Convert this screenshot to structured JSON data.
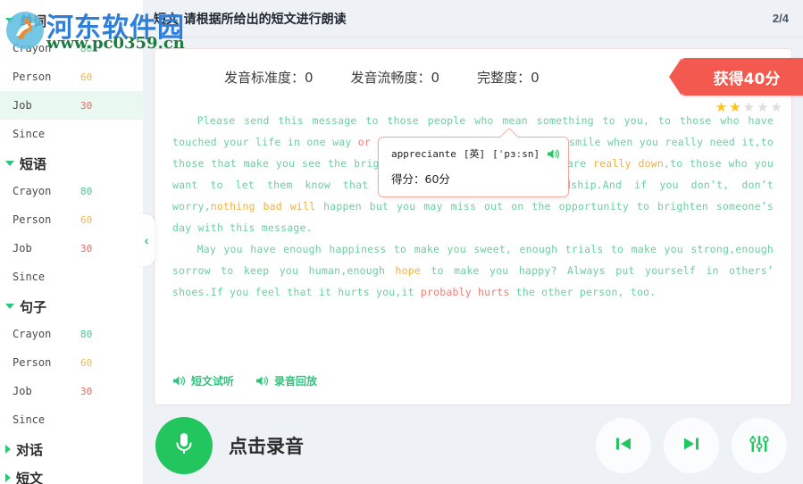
{
  "watermark": {
    "name": "河东软件园",
    "url": "www.pc0359.cn"
  },
  "sidebar": {
    "groups": [
      {
        "title": "单词",
        "expanded": true,
        "items": [
          {
            "label": "Crayon",
            "score": "80",
            "tone": "green",
            "active": false
          },
          {
            "label": "Person",
            "score": "60",
            "tone": "orange",
            "active": false
          },
          {
            "label": "Job",
            "score": "30",
            "tone": "red",
            "active": true
          },
          {
            "label": "Since",
            "score": "",
            "tone": "",
            "active": false
          }
        ]
      },
      {
        "title": "短语",
        "expanded": true,
        "items": [
          {
            "label": "Crayon",
            "score": "80",
            "tone": "green",
            "active": false
          },
          {
            "label": "Person",
            "score": "60",
            "tone": "orange",
            "active": false
          },
          {
            "label": "Job",
            "score": "30",
            "tone": "red",
            "active": false
          },
          {
            "label": "Since",
            "score": "",
            "tone": "",
            "active": false
          }
        ]
      },
      {
        "title": "句子",
        "expanded": true,
        "items": [
          {
            "label": "Crayon",
            "score": "80",
            "tone": "green",
            "active": false
          },
          {
            "label": "Person",
            "score": "60",
            "tone": "orange",
            "active": false
          },
          {
            "label": "Job",
            "score": "30",
            "tone": "red",
            "active": false
          },
          {
            "label": "Since",
            "score": "",
            "tone": "",
            "active": false
          }
        ]
      },
      {
        "title": "对话",
        "expanded": false,
        "items": []
      },
      {
        "title": "短文",
        "expanded": false,
        "items": []
      }
    ],
    "collapse_handle": "‹"
  },
  "topbar": {
    "title": "短文:请根据所给出的短文进行朗读",
    "page": "2/4"
  },
  "scores": {
    "accuracy": "发音标准度：0",
    "fluency": "发音流畅度：0",
    "integrity": "完整度：0",
    "ribbon": "获得40分",
    "stars_total": 5,
    "stars_filled": 2
  },
  "tooltip": {
    "word": "appreciante",
    "lang_tag": "[英]",
    "phonetic": "[ˈpɜːsn]",
    "speaker_icon": "speaker-icon",
    "score_line": "得分：60分"
  },
  "passage": {
    "paragraphs": [
      [
        {
          "t": "Please send this message to those people who mean something to you, to those who have touched your life in one way ",
          "c": "good"
        },
        {
          "t": "or another",
          "c": "bad"
        },
        {
          "t": ",to those who make you smile when you really need it,to those that make you see the brighter side of things when you are ",
          "c": "good"
        },
        {
          "t": "really down",
          "c": "warn"
        },
        {
          "t": ",to those who you want to let them know that you ",
          "c": "good"
        },
        {
          "t": "appreciate",
          "c": "bad"
        },
        {
          "t": " their friendship.And if you don’t, don’t worry,",
          "c": "good"
        },
        {
          "t": "nothing bad will",
          "c": "warn"
        },
        {
          "t": " happen but you may miss out on the opportunity to brighten someone’s day with this message.",
          "c": "good"
        }
      ],
      [
        {
          "t": "May you have enough happiness to make you sweet, enough trials to make you strong,enough sorrow to keep you human,enough ",
          "c": "good"
        },
        {
          "t": "hope",
          "c": "warn"
        },
        {
          "t": " to make you happy? Always put yourself in others’ shoes.If you feel that it hurts you,it ",
          "c": "good"
        },
        {
          "t": "probably hurts",
          "c": "bad"
        },
        {
          "t": " the other person, too.",
          "c": "good"
        }
      ]
    ]
  },
  "audio_links": [
    {
      "label": "短文试听",
      "icon": "speaker-icon"
    },
    {
      "label": "录音回放",
      "icon": "speaker-icon"
    }
  ],
  "footer": {
    "record_label": "点击录音",
    "mic_icon": "microphone-icon",
    "controls": [
      {
        "name": "previous-button",
        "icon": "skip-previous-icon"
      },
      {
        "name": "next-button",
        "icon": "skip-next-icon"
      },
      {
        "name": "settings-button",
        "icon": "sliders-icon"
      }
    ]
  },
  "colors": {
    "accent_green": "#22c55e",
    "ribbon_red": "#f4594f",
    "star_gold": "#ffc017",
    "good": "#6ccfa0",
    "warn": "#f0b03c",
    "bad": "#ef7d74"
  }
}
